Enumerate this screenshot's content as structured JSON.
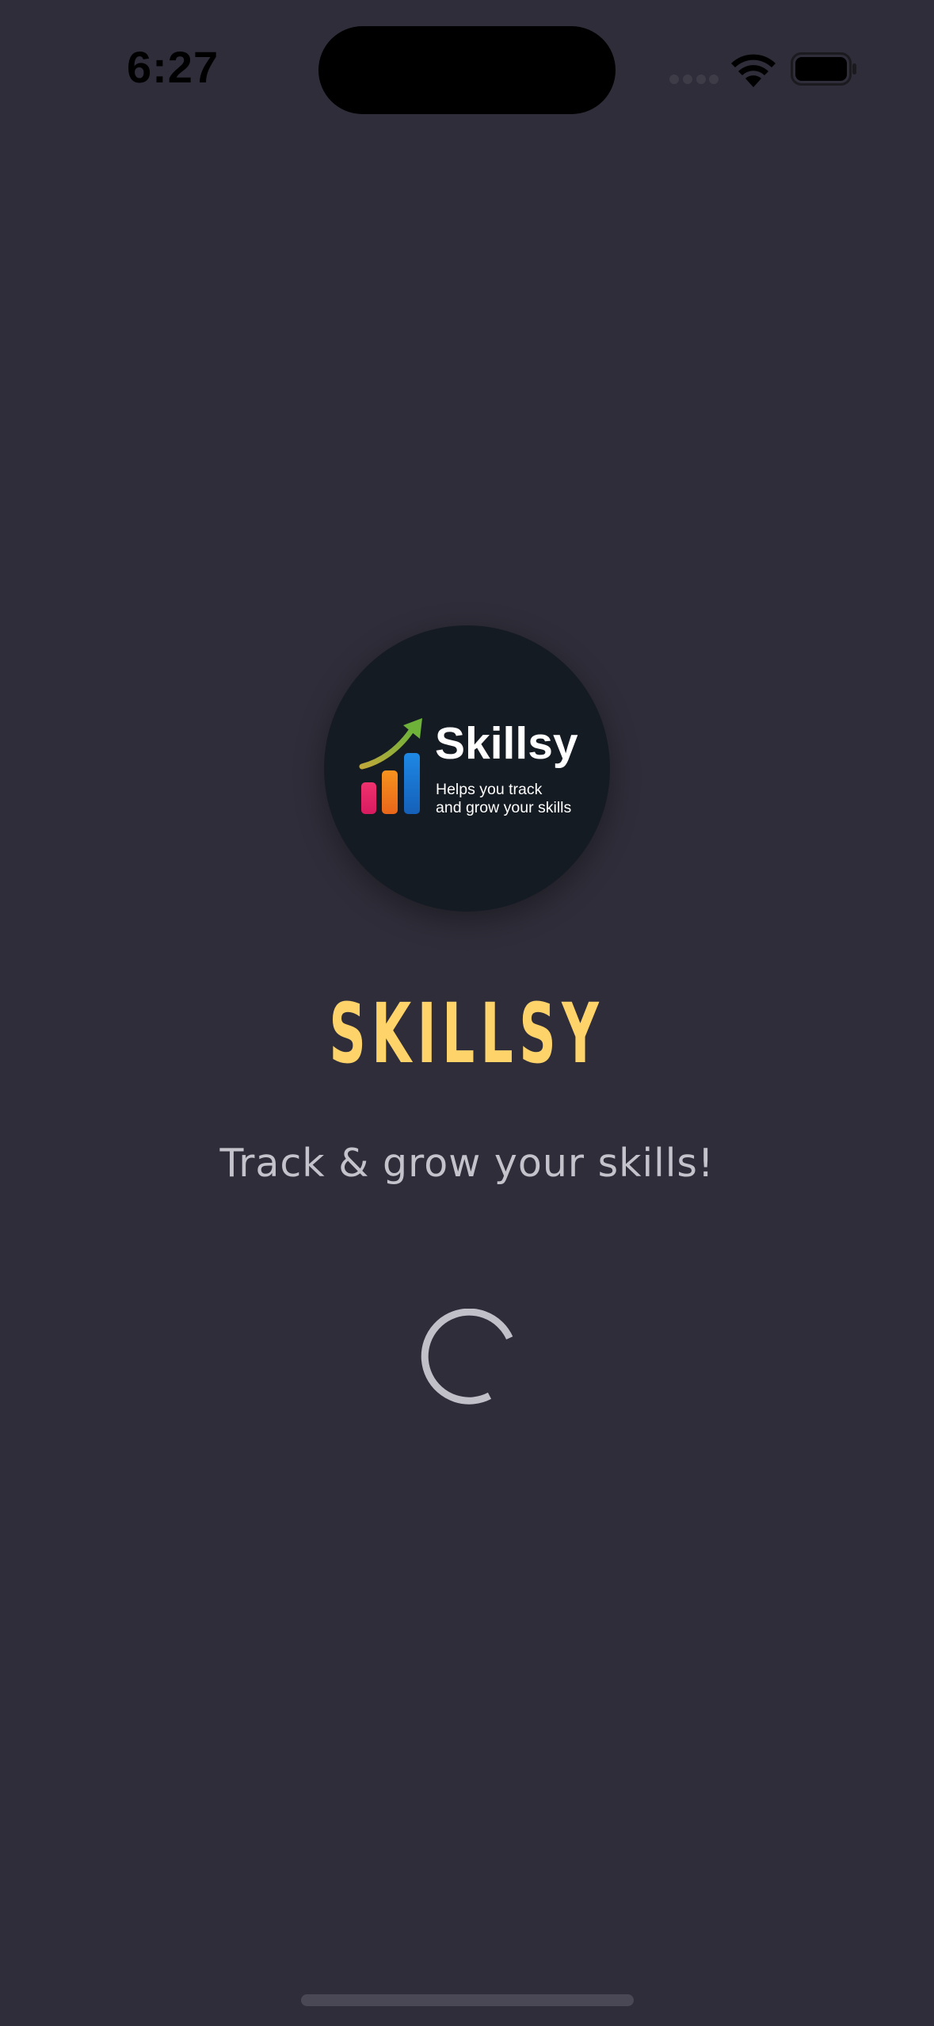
{
  "status_bar": {
    "time": "6:27"
  },
  "logo": {
    "brand_name": "Skillsy",
    "subtitle_line1": "Helps you track",
    "subtitle_line2": "and grow your skills"
  },
  "splash": {
    "title": "SKILLSY",
    "tagline": "Track & grow your skills!"
  },
  "colors": {
    "background": "#2f2d39",
    "title": "#fdd36a",
    "tagline": "#c4c2cb",
    "logo_background": "#151b22",
    "bar_pink": "#e81e63",
    "bar_orange": "#f57c1f",
    "bar_blue": "#1976d2",
    "arrow_green": "#7cb342"
  },
  "icons": {
    "signal": "cellular-signal-icon",
    "wifi": "wifi-icon",
    "battery": "battery-icon",
    "loading": "loading-spinner-icon"
  }
}
